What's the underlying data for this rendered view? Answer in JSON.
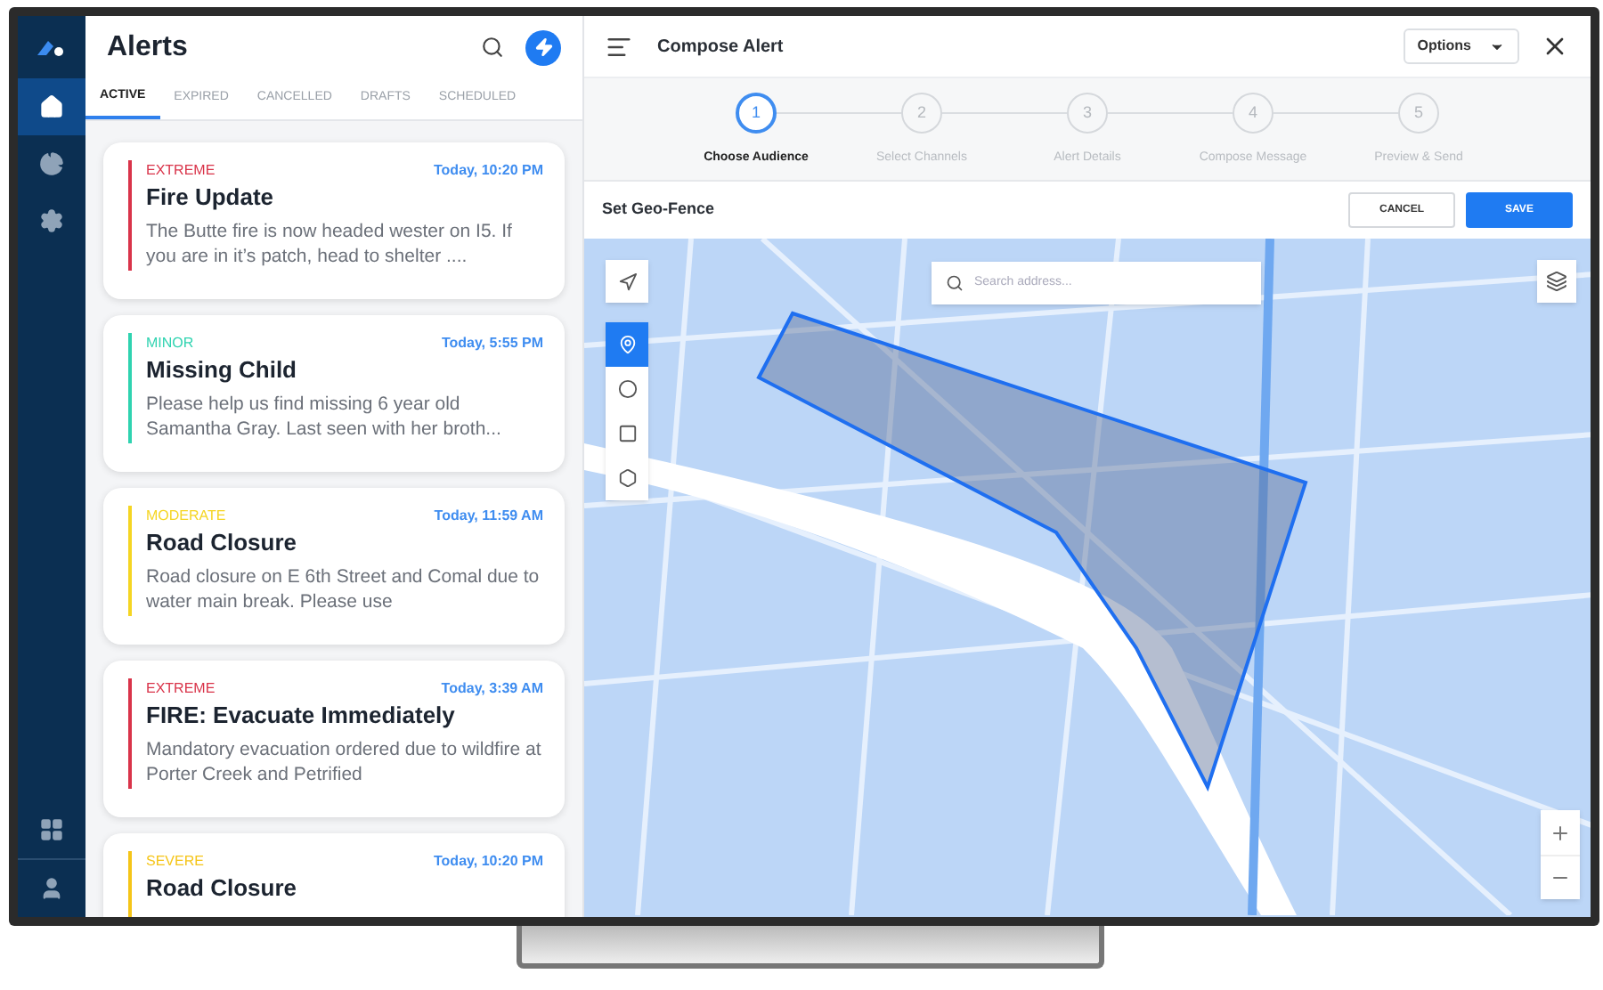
{
  "sidebar": {
    "items": [
      {
        "kind": "home",
        "selected": true
      },
      {
        "kind": "chart",
        "selected": false
      },
      {
        "kind": "settings",
        "selected": false
      }
    ],
    "bottom_items": [
      {
        "kind": "apps",
        "selected": false
      },
      {
        "kind": "profile",
        "selected": false
      }
    ]
  },
  "alerts": {
    "title": "Alerts",
    "tabs": [
      {
        "label": "ACTIVE",
        "selected": true
      },
      {
        "label": "EXPIRED",
        "selected": false
      },
      {
        "label": "CANCELLED",
        "selected": false
      },
      {
        "label": "DRAFTS",
        "selected": false
      },
      {
        "label": "SCHEDULED",
        "selected": false
      }
    ],
    "items": [
      {
        "severity": "EXTREME",
        "color": "#d9344a",
        "time": "Today, 10:20 PM",
        "title": "Fire Update",
        "body": "The Butte fire is now headed wester on I5. If you are in it’s patch, head to shelter ...."
      },
      {
        "severity": "MINOR",
        "color": "#2fd3b0",
        "time": "Today, 5:55 PM",
        "title": "Missing Child",
        "body": "Please help us find missing 6 year old Samantha Gray. Last seen with her broth..."
      },
      {
        "severity": "MODERATE",
        "color": "#f5d523",
        "time": "Today, 11:59 AM",
        "title": "Road Closure",
        "body": "Road closure on E 6th Street and Comal due to water main break. Please use"
      },
      {
        "severity": "EXTREME",
        "color": "#d9344a",
        "time": "Today, 3:39 AM",
        "title": "FIRE: Evacuate Immediately",
        "body": "Mandatory evacuation ordered due to wildfire at Porter Creek and Petrified"
      },
      {
        "severity": "SEVERE",
        "color": "#f5c518",
        "time": "Today, 10:20 PM",
        "title": "Road Closure"
      }
    ]
  },
  "compose": {
    "title": "Compose Alert",
    "options": "Options",
    "steps": [
      {
        "number": "1",
        "label": "Choose Audience",
        "selected": true
      },
      {
        "number": "2",
        "label": "Select Channels",
        "selected": false
      },
      {
        "number": "3",
        "label": "Alert Details",
        "selected": false
      },
      {
        "number": "4",
        "label": "Compose Message",
        "selected": false
      },
      {
        "number": "5",
        "label": "Preview & Send",
        "selected": false
      }
    ],
    "section_title": "Set Geo-Fence",
    "cancel": "CANCEL",
    "save": "SAVE",
    "map": {
      "search_placeholder": "Search address...",
      "tools": [
        {
          "kind": "pin",
          "selected": true
        },
        {
          "kind": "circle",
          "selected": false
        },
        {
          "kind": "rectangle",
          "selected": false
        },
        {
          "kind": "polygon",
          "selected": false
        }
      ]
    }
  }
}
